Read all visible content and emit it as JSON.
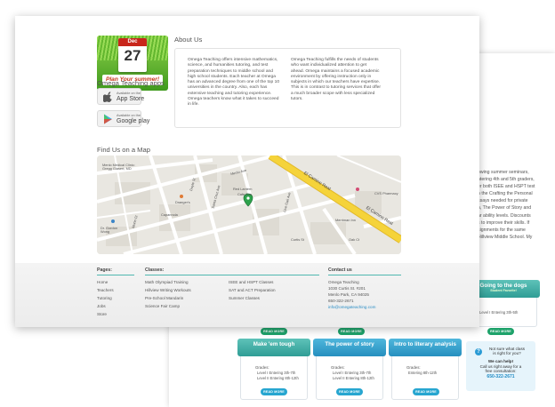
{
  "main": {
    "promo": {
      "month": "Dec",
      "day": "27",
      "banner": "Plan Your summer!"
    },
    "apps_heading": "Omega Teaching apps",
    "app_store": {
      "small": "Available on the",
      "big": "App Store"
    },
    "google_play": {
      "small": "Available on the",
      "big": "Google play"
    },
    "about_heading": "About Us",
    "about_col1": [
      "Omega Teaching offers intensive mathematics,",
      "science, and humanities tutoring, and test",
      "preparation techniques to middle school and",
      "high school students. Each teacher at Omega",
      "has an advanced degree from one of the top 10",
      "universities in the country. Also, each has",
      "extensive teaching and tutoring experience.",
      "Omega teachers know what it takes to succeed",
      "in life."
    ],
    "about_col2": [
      "Omega Teaching fulfills the needs of students",
      "who want individualized attention to get",
      "ahead. Omega maintains a focused academic",
      "environment by offering instruction only in",
      "subjects in which our teachers have expertise.",
      "This is in contrast to tutoring services that offer",
      "a much broader scope with less specialized",
      "tutors."
    ],
    "map_heading": "Find Us on a Map",
    "map_labels": [
      "Menlo Medical Clinic: Gregg Glasert, MD",
      "Draeger's",
      "Red Lantern",
      "Cafe Zoe",
      "Capannola",
      "Dr. Gordon Wong",
      "El Camino Real",
      "El Camino Real",
      "CVS Pharmacy",
      "Merriman Inn",
      "Curtis St",
      "Oak Ct",
      "Santa Cruz Ave",
      "Menlo Ave",
      "Live Oak Ave",
      "Doyle St",
      "Morin Ct"
    ]
  },
  "footer": {
    "pages_heading": "Pages:",
    "pages": [
      "Home",
      "Teachers",
      "Tutoring",
      "Jobs",
      "Store"
    ],
    "classes_heading": "Classes:",
    "classes_col1": [
      "Math Olympiad Training",
      "Hillview Writing Workouts",
      "Pre-School Mandarin",
      "Science Fair Camp"
    ],
    "classes_col2": [
      "ISEE and HSPT Classes",
      "SAT and ACT Preparation",
      "Summer Classes"
    ],
    "contact_heading": "Contact us",
    "contact": [
      "Omega Teaching",
      "1030 Curtis St. #201",
      "Menlo Park, CA 94025",
      "650-322-2671"
    ],
    "email": "info@omegateaching.com"
  },
  "back": {
    "body_lines": [
      "owing summer seminars,",
      "ntering 4th and 5th graders,",
      "er both ISEE and HSPT test",
      "n the Crafting the Personal",
      "ssays needed for private",
      "",
      "h, The Power of Story and",
      "ar ability levels. Discounts",
      "s to improve their skills. If",
      "signments for the same",
      "Hillview Middle School. My"
    ],
    "read_more": "READ MORE",
    "card_dogs": {
      "title": "Going to the dogs",
      "subtitle": "Student Favorite!",
      "level": "Level I Entering 3th-5th"
    },
    "card_tough": {
      "title": "Make 'em tough",
      "grades": "Grades:",
      "l1": "Level I Entering 3th-7th",
      "l2": "Level II Entering 8th-12th"
    },
    "card_story": {
      "title": "The power of story",
      "grades": "Grades:",
      "l1": "Level I Entering 3th-7th",
      "l2": "Level II Entering 8th-12th"
    },
    "card_intro": {
      "title": "Intro to literary analysis",
      "grades": "Grades:",
      "l1": "Entering 8th-12th"
    },
    "help": {
      "q1": "Not sure what class",
      "q2": "is right for you?",
      "c1": "We can help!",
      "c2": "Call us right away for a",
      "c3": "free consultation:",
      "phone": "650-322-2671"
    }
  },
  "colors": {
    "accent_teal": "#4fb8b0",
    "promo_red": "#c8261b",
    "read_more_green": "#1ea26a",
    "read_more_blue": "#27a6d0",
    "map_road_yellow": "#f5d33a"
  },
  "icons": {
    "app_store": "apple-icon",
    "google_play": "play-icon",
    "map_marker": "map-pin-icon",
    "help": "question-icon"
  }
}
